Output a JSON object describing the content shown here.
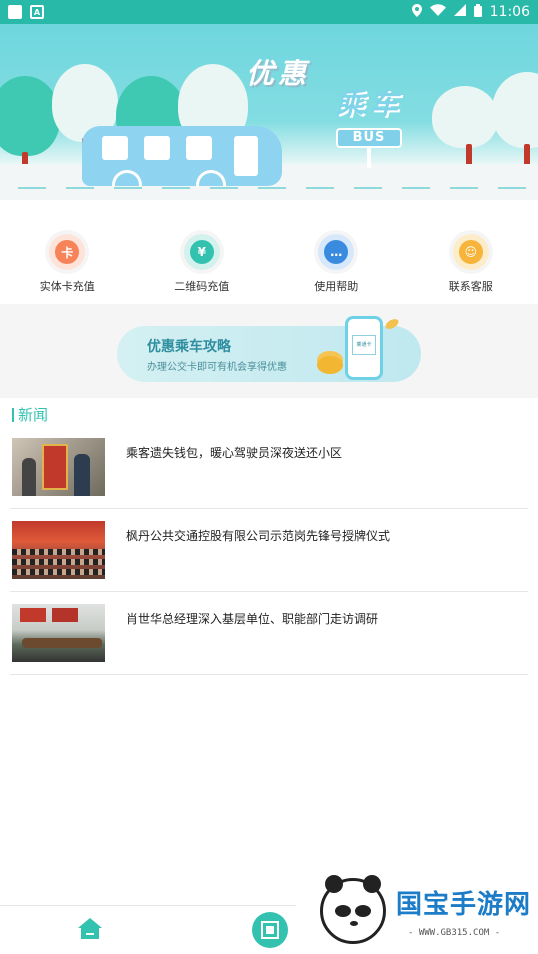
{
  "status_bar": {
    "time": "11:06",
    "left_icons": [
      "square-icon",
      "a-icon"
    ],
    "right_icons": [
      "location-icon",
      "wifi-icon",
      "signal-icon",
      "battery-icon"
    ]
  },
  "banner": {
    "title_line1": "优惠",
    "title_line2": "乘车",
    "bus_sign": "BUS"
  },
  "quick_actions": [
    {
      "label": "实体卡充值",
      "icon": "physical-card-icon",
      "color": "#f7835a",
      "glyph": "卡"
    },
    {
      "label": "二维码充值",
      "icon": "qr-recharge-icon",
      "color": "#34c2b0",
      "glyph": "¥"
    },
    {
      "label": "使用帮助",
      "icon": "help-chat-icon",
      "color": "#3a8be0",
      "glyph": "…"
    },
    {
      "label": "联系客服",
      "icon": "customer-service-icon",
      "color": "#f6b43a",
      "glyph": "☺"
    }
  ],
  "promo": {
    "title": "优惠乘车攻略",
    "subtitle": "办理公交卡即可有机会享得优惠",
    "phone_label": "乘通卡"
  },
  "news": {
    "header": "新闻",
    "items": [
      {
        "title": "乘客遗失钱包，暖心驾驶员深夜送还小区"
      },
      {
        "title": "枫丹公共交通控股有限公司示范岗先锋号授牌仪式"
      },
      {
        "title": "肖世华总经理深入基层单位、职能部门走访调研"
      }
    ]
  },
  "bottom_nav": {
    "items": [
      "home-icon",
      "qr-scan-icon"
    ]
  },
  "watermark": {
    "title": "国宝手游网",
    "url": "- WWW.GB315.COM -"
  }
}
